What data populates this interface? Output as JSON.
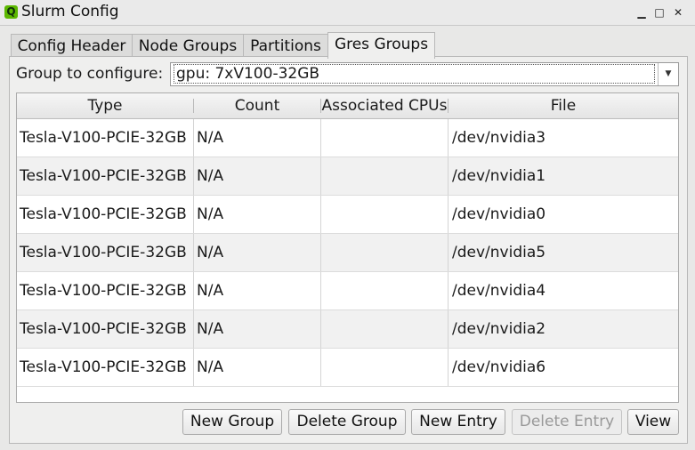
{
  "window": {
    "title": "Slurm Config",
    "app_icon_glyph": "Q",
    "icons": [
      "minimize-icon",
      "maximize-icon",
      "close-icon"
    ]
  },
  "tabs": [
    {
      "label": "Config Header"
    },
    {
      "label": "Node Groups"
    },
    {
      "label": "Partitions"
    },
    {
      "label": "Gres Groups",
      "active": true
    }
  ],
  "group": {
    "label": "Group to configure:",
    "value": "gpu: 7xV100-32GB"
  },
  "table": {
    "columns": [
      "Type",
      "Count",
      "Associated CPUs",
      "File"
    ],
    "rows": [
      {
        "type": "Tesla-V100-PCIE-32GB",
        "count": "N/A",
        "cpus": "",
        "file": "/dev/nvidia3"
      },
      {
        "type": "Tesla-V100-PCIE-32GB",
        "count": "N/A",
        "cpus": "",
        "file": "/dev/nvidia1"
      },
      {
        "type": "Tesla-V100-PCIE-32GB",
        "count": "N/A",
        "cpus": "",
        "file": "/dev/nvidia0"
      },
      {
        "type": "Tesla-V100-PCIE-32GB",
        "count": "N/A",
        "cpus": "",
        "file": "/dev/nvidia5"
      },
      {
        "type": "Tesla-V100-PCIE-32GB",
        "count": "N/A",
        "cpus": "",
        "file": "/dev/nvidia4"
      },
      {
        "type": "Tesla-V100-PCIE-32GB",
        "count": "N/A",
        "cpus": "",
        "file": "/dev/nvidia2"
      },
      {
        "type": "Tesla-V100-PCIE-32GB",
        "count": "N/A",
        "cpus": "",
        "file": "/dev/nvidia6"
      }
    ]
  },
  "buttons": {
    "new_group": "New Group",
    "delete_group": "Delete Group",
    "new_entry": "New Entry",
    "delete_entry": "Delete Entry",
    "view": "View"
  },
  "colors": {
    "accent": "#5cb800",
    "background": "#e8e8e7",
    "disabled_text": "#999999"
  }
}
